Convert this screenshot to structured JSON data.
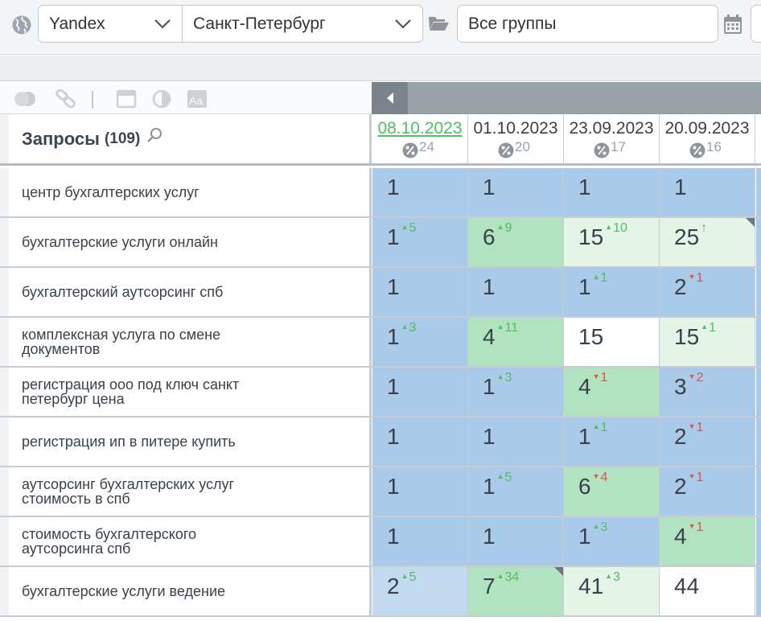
{
  "toolbar": {
    "search_engine": "Yandex",
    "region": "Санкт-Петербург",
    "group": "Все группы"
  },
  "colors": {
    "top_position": "#a9cbe9",
    "improved": "#b1e3c0",
    "accent_green": "#4fbf62",
    "decline_red": "#d9534f"
  },
  "header": {
    "title": "Запросы",
    "count": "(109)",
    "dates": [
      {
        "date": "08.10.2023",
        "pct": "24",
        "active": true
      },
      {
        "date": "01.10.2023",
        "pct": "20",
        "active": false
      },
      {
        "date": "23.09.2023",
        "pct": "17",
        "active": false
      },
      {
        "date": "20.09.2023",
        "pct": "16",
        "active": false
      }
    ]
  },
  "rows": [
    {
      "query": "центр бухгалтерских услуг",
      "cells": [
        {
          "pos": "1",
          "ch": "",
          "dir": "",
          "bg": "blue"
        },
        {
          "pos": "1",
          "ch": "",
          "dir": "",
          "bg": "blue"
        },
        {
          "pos": "1",
          "ch": "",
          "dir": "",
          "bg": "blue"
        },
        {
          "pos": "1",
          "ch": "",
          "dir": "",
          "bg": "blue"
        }
      ]
    },
    {
      "query": "бухгалтерские услуги онлайн",
      "cells": [
        {
          "pos": "1",
          "ch": "5",
          "dir": "up",
          "bg": "blue"
        },
        {
          "pos": "6",
          "ch": "9",
          "dir": "up",
          "bg": "green"
        },
        {
          "pos": "15",
          "ch": "10",
          "dir": "up",
          "bg": "lgreen"
        },
        {
          "pos": "25",
          "ch": "↑",
          "dir": "up",
          "bg": "lgreen",
          "corner": true
        }
      ]
    },
    {
      "query": "бухгалтерский аутсорсинг спб",
      "cells": [
        {
          "pos": "1",
          "ch": "",
          "dir": "",
          "bg": "blue"
        },
        {
          "pos": "1",
          "ch": "",
          "dir": "",
          "bg": "blue"
        },
        {
          "pos": "1",
          "ch": "1",
          "dir": "up",
          "bg": "blue"
        },
        {
          "pos": "2",
          "ch": "1",
          "dir": "down",
          "bg": "blue"
        }
      ]
    },
    {
      "query": "комплексная услуга по смене документов",
      "cells": [
        {
          "pos": "1",
          "ch": "3",
          "dir": "up",
          "bg": "blue"
        },
        {
          "pos": "4",
          "ch": "11",
          "dir": "up",
          "bg": "green"
        },
        {
          "pos": "15",
          "ch": "",
          "dir": "",
          "bg": "white"
        },
        {
          "pos": "15",
          "ch": "1",
          "dir": "up",
          "bg": "lgreen"
        }
      ]
    },
    {
      "query": "регистрация ооо под ключ санкт петербург цена",
      "cells": [
        {
          "pos": "1",
          "ch": "",
          "dir": "",
          "bg": "blue"
        },
        {
          "pos": "1",
          "ch": "3",
          "dir": "up",
          "bg": "blue"
        },
        {
          "pos": "4",
          "ch": "1",
          "dir": "down",
          "bg": "green"
        },
        {
          "pos": "3",
          "ch": "2",
          "dir": "down",
          "bg": "blue"
        }
      ]
    },
    {
      "query": "регистрация ип в питере купить",
      "cells": [
        {
          "pos": "1",
          "ch": "",
          "dir": "",
          "bg": "blue"
        },
        {
          "pos": "1",
          "ch": "",
          "dir": "",
          "bg": "blue"
        },
        {
          "pos": "1",
          "ch": "1",
          "dir": "up",
          "bg": "blue"
        },
        {
          "pos": "2",
          "ch": "1",
          "dir": "down",
          "bg": "blue"
        }
      ]
    },
    {
      "query": "аутсорсинг бухгалтерских услуг стоимость в спб",
      "cells": [
        {
          "pos": "1",
          "ch": "",
          "dir": "",
          "bg": "blue"
        },
        {
          "pos": "1",
          "ch": "5",
          "dir": "up",
          "bg": "blue"
        },
        {
          "pos": "6",
          "ch": "4",
          "dir": "down",
          "bg": "green"
        },
        {
          "pos": "2",
          "ch": "1",
          "dir": "down",
          "bg": "blue"
        }
      ]
    },
    {
      "query": "стоимость бухгалтерского аутсорсинга спб",
      "cells": [
        {
          "pos": "1",
          "ch": "",
          "dir": "",
          "bg": "blue"
        },
        {
          "pos": "1",
          "ch": "",
          "dir": "",
          "bg": "blue"
        },
        {
          "pos": "1",
          "ch": "3",
          "dir": "up",
          "bg": "blue"
        },
        {
          "pos": "4",
          "ch": "1",
          "dir": "down",
          "bg": "green"
        }
      ]
    },
    {
      "query": "бухгалтерские услуги ведение",
      "cells": [
        {
          "pos": "2",
          "ch": "5",
          "dir": "up",
          "bg": "lblue"
        },
        {
          "pos": "7",
          "ch": "34",
          "dir": "up",
          "bg": "green",
          "corner": true
        },
        {
          "pos": "41",
          "ch": "3",
          "dir": "up",
          "bg": "lgreen"
        },
        {
          "pos": "44",
          "ch": "",
          "dir": "",
          "bg": "white"
        }
      ]
    }
  ]
}
